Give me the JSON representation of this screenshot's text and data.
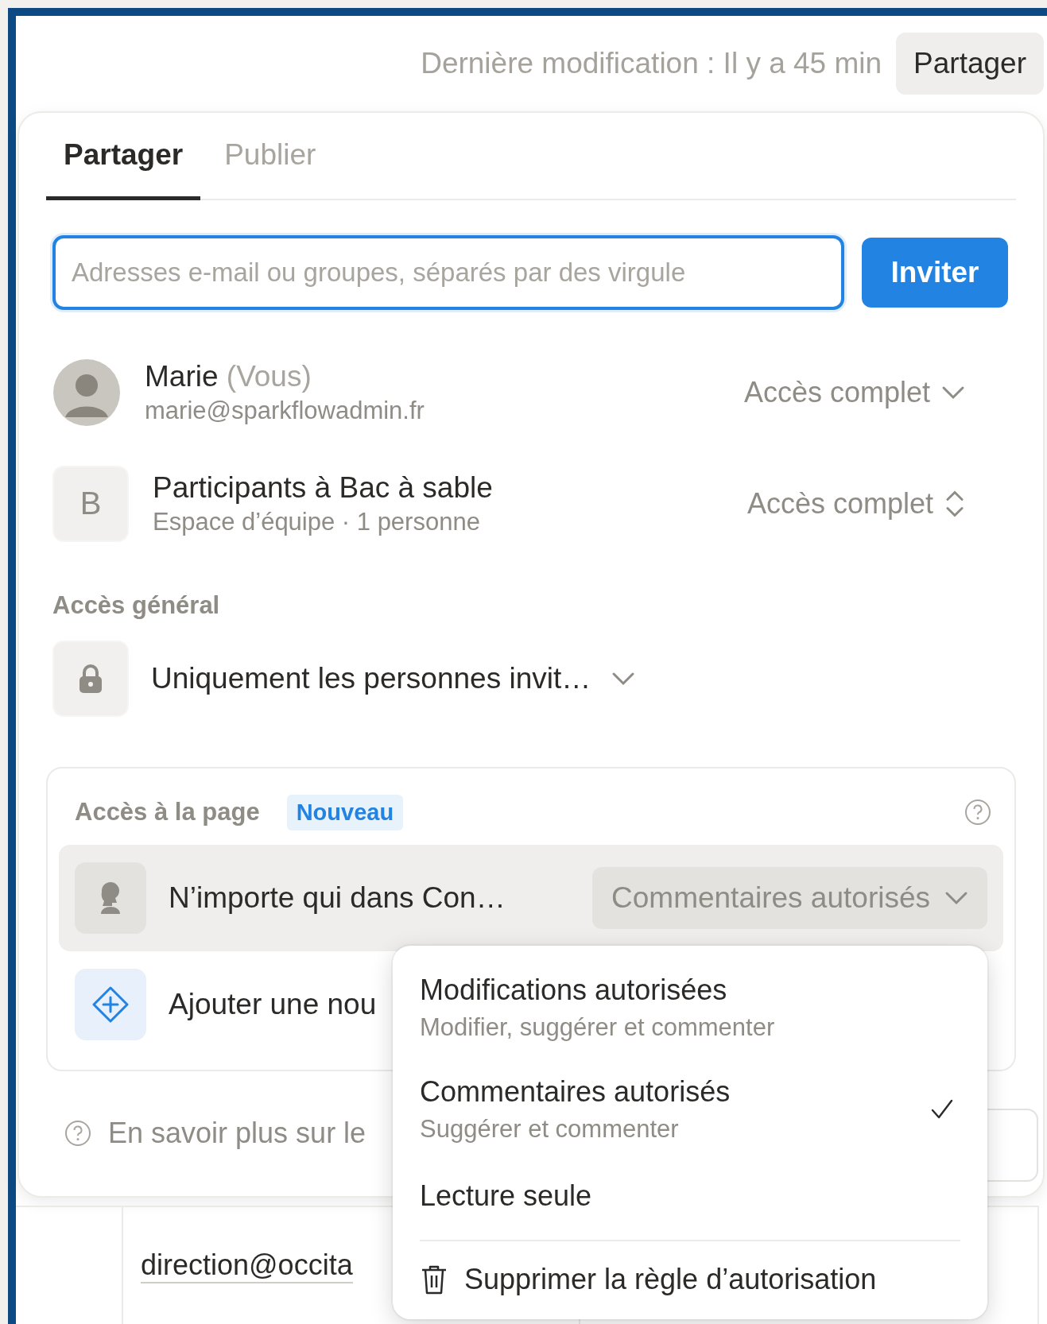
{
  "topbar": {
    "last_modified": "Dernière modification : Il y a 45 min",
    "share_button": "Partager"
  },
  "share_panel": {
    "tabs": [
      {
        "label": "Partager",
        "selected": true
      },
      {
        "label": "Publier",
        "selected": false
      }
    ],
    "invite": {
      "placeholder": "Adresses e-mail ou groupes, séparés par des virgule",
      "button": "Inviter"
    },
    "members": [
      {
        "kind": "person",
        "name": "Marie",
        "note": "(Vous)",
        "detail": "marie@sparkflowadmin.fr",
        "access": {
          "label": "Accès complet",
          "kind": "chevron"
        }
      },
      {
        "kind": "group",
        "initial": "B",
        "name": "Participants à Bac à sable",
        "detail": "Espace d’équipe · 1 personne",
        "access": {
          "label": "Accès complet",
          "kind": "updown"
        }
      }
    ],
    "general_access": {
      "heading": "Accès général",
      "value": "Uniquement les personnes invit…"
    },
    "page_access": {
      "heading": "Accès à la page",
      "badge": "Nouveau",
      "rules": [
        {
          "label": "N’importe qui dans Con…",
          "permission": "Commentaires autorisés",
          "selected": true
        }
      ],
      "add_label": "Ajouter une nou"
    },
    "footer_link": "En savoir plus sur le"
  },
  "background_cells": [
    "direction@occita"
  ],
  "permission_menu": {
    "options": [
      {
        "title": "Modifications autorisées",
        "description": "Modifier, suggérer et commenter",
        "selected": false
      },
      {
        "title": "Commentaires autorisés",
        "description": "Suggérer et commenter",
        "selected": true
      },
      {
        "title": "Lecture seule",
        "selected": false
      }
    ],
    "delete": "Supprimer la règle d’autorisation"
  }
}
